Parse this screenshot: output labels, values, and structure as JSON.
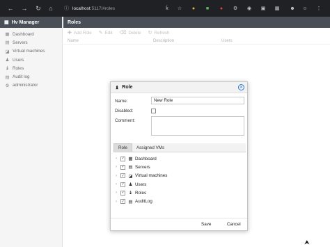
{
  "browser": {
    "url_host": "localhost",
    "url_path": ":5117/#roles",
    "icons": [
      "back-icon",
      "forward-icon",
      "refresh-icon",
      "home-icon",
      "site-info-icon"
    ]
  },
  "app": {
    "title": "Hv Manager",
    "sidebar": {
      "items": [
        {
          "label": "Dashboard",
          "icon": "dashboard-icon"
        },
        {
          "label": "Servers",
          "icon": "server-icon"
        },
        {
          "label": "Virtual machines",
          "icon": "vm-icon"
        },
        {
          "label": "Users",
          "icon": "user-icon"
        },
        {
          "label": "Roles",
          "icon": "roles-icon"
        },
        {
          "label": "Audit log",
          "icon": "audit-log-icon"
        },
        {
          "label": "administrator",
          "icon": "admin-icon"
        }
      ]
    }
  },
  "page": {
    "title": "Roles",
    "toolbar": {
      "add": "Add Role",
      "edit": "Edit",
      "delete": "Delete",
      "refresh": "Refresh"
    },
    "columns": [
      "Name",
      "Description",
      "Users"
    ]
  },
  "dialog": {
    "title": "Role",
    "name_label": "Name:",
    "name_value": "New Role",
    "disabled_label": "Disabled:",
    "disabled_checked": false,
    "comment_label": "Comment:",
    "comment_value": "",
    "tabs": [
      "Role",
      "Assigned VMs"
    ],
    "selected_tab": "Role",
    "tree": [
      {
        "label": "Dashboard",
        "checked": true,
        "icon": "dashboard-icon"
      },
      {
        "label": "Servers",
        "checked": true,
        "icon": "server-icon"
      },
      {
        "label": "Virtual machines",
        "checked": true,
        "icon": "vm-icon"
      },
      {
        "label": "Users",
        "checked": true,
        "icon": "user-icon"
      },
      {
        "label": "Roles",
        "checked": true,
        "icon": "roles-icon"
      },
      {
        "label": "AuditLog",
        "checked": true,
        "icon": "audit-log-icon"
      }
    ],
    "save": "Save",
    "cancel": "Cancel"
  },
  "colors": {
    "header_bg": "#4a4f57",
    "accent": "#2b7bd8",
    "browser_bg": "#202124"
  }
}
